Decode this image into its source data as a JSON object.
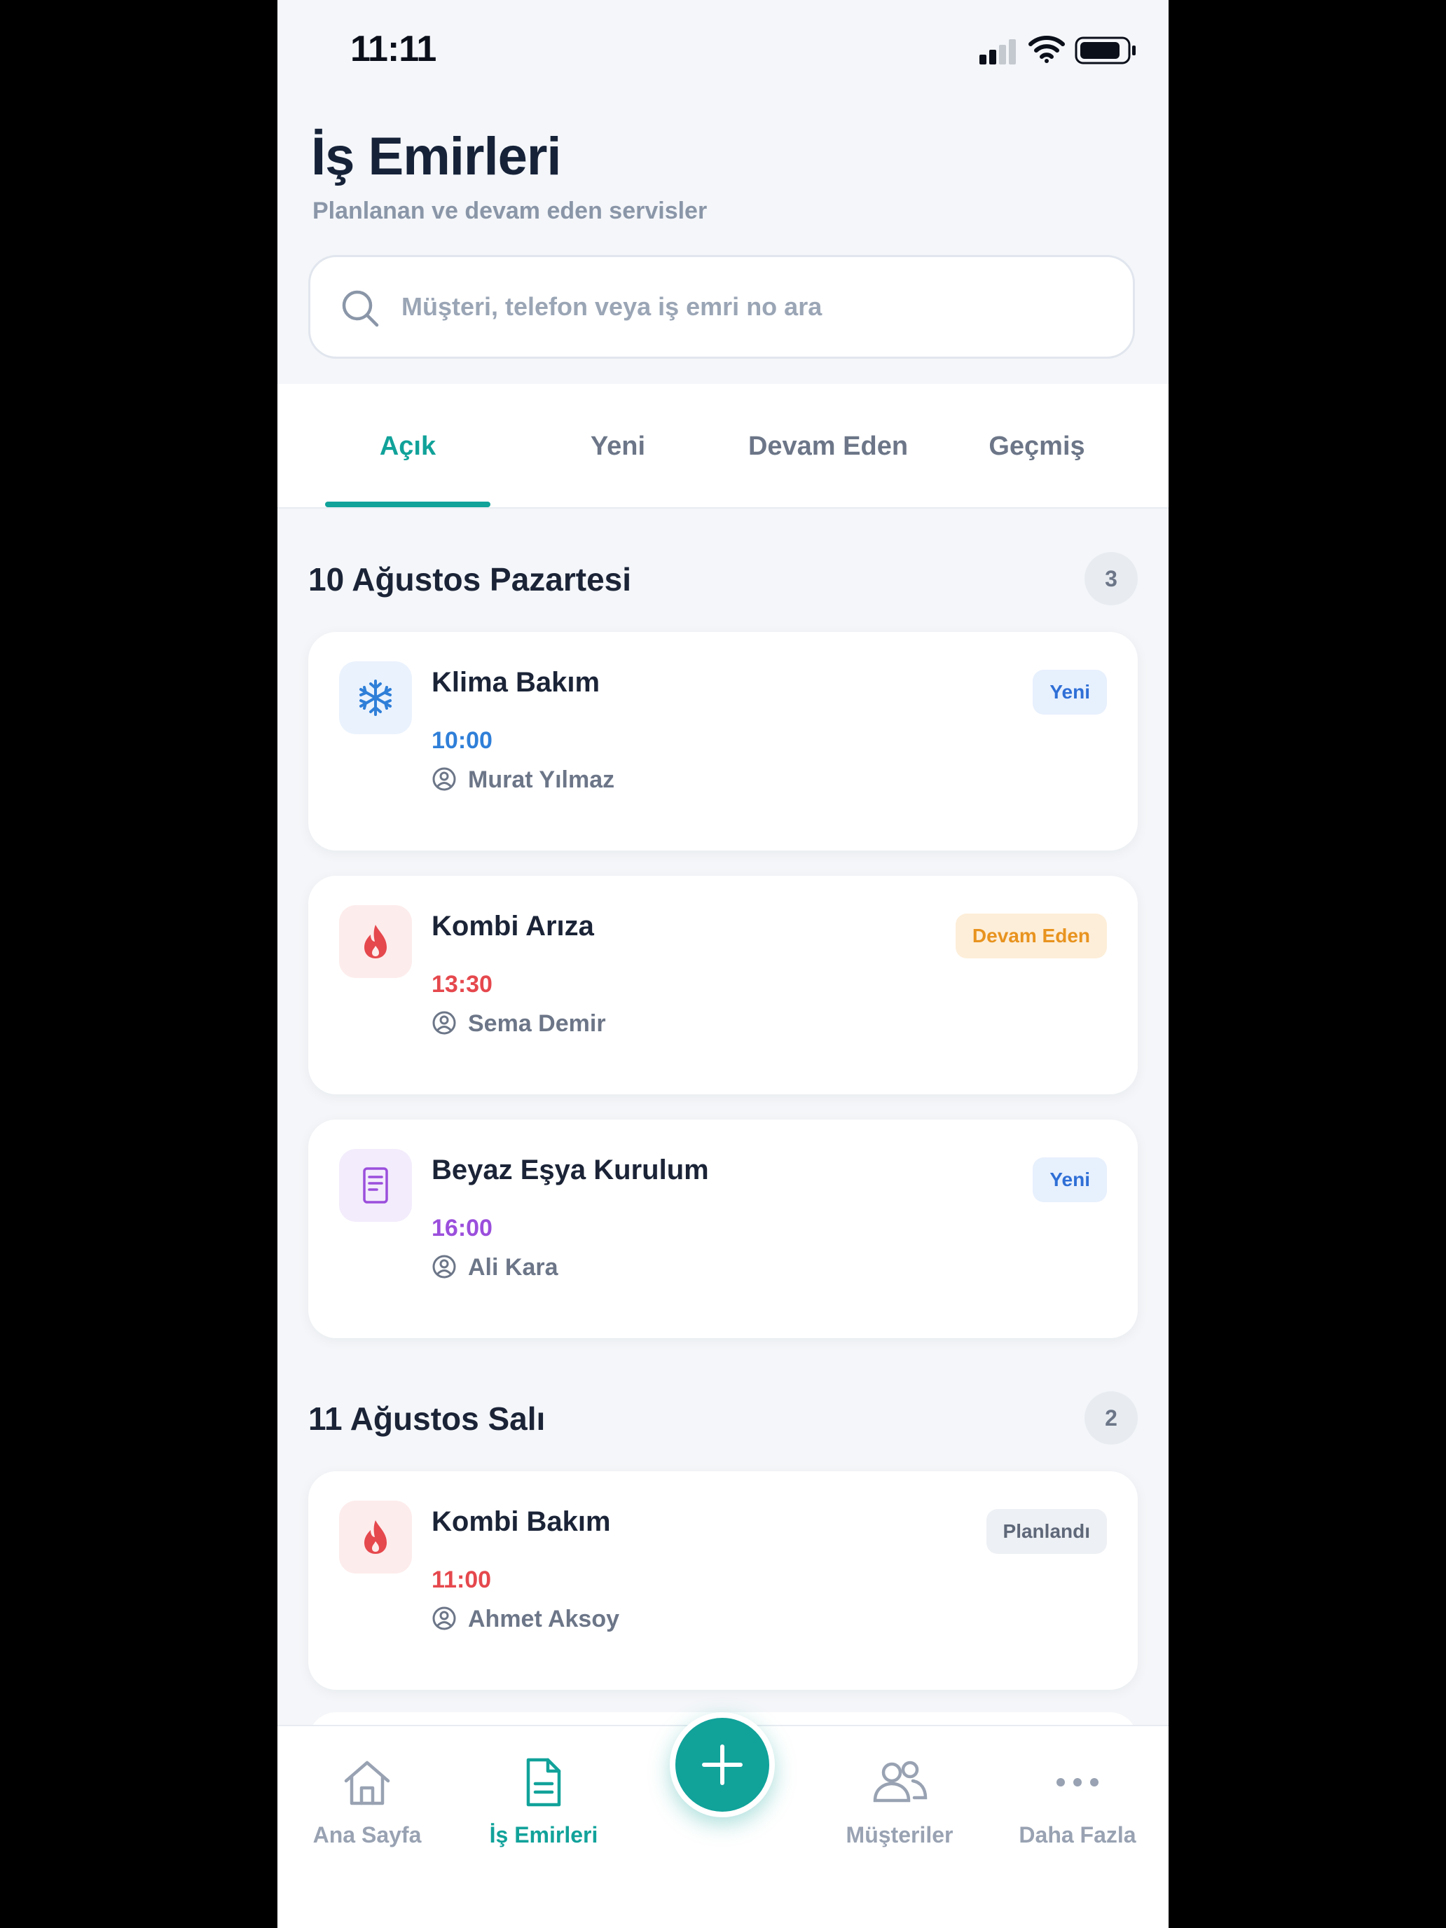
{
  "status_bar": {
    "time": "11:11"
  },
  "header": {
    "title": "İş Emirleri",
    "subtitle": "Planlanan ve devam eden servisler"
  },
  "search": {
    "placeholder": "Müşteri, telefon veya iş emri no ara"
  },
  "tabs": [
    {
      "label": "Açık",
      "active": true
    },
    {
      "label": "Yeni",
      "active": false
    },
    {
      "label": "Devam Eden",
      "active": false
    },
    {
      "label": "Geçmiş",
      "active": false
    }
  ],
  "sections": [
    {
      "title": "10 Ağustos Pazartesi",
      "count": "3",
      "items": [
        {
          "title": "Klima Bakım",
          "time": "10:00",
          "customer": "Murat Yılmaz",
          "status": "Yeni",
          "icon": "snowflake-icon",
          "color": "#2f7fd8",
          "icon_bg": "#eaf2fd"
        },
        {
          "title": "Kombi Arıza",
          "time": "13:30",
          "customer": "Sema Demir",
          "status": "Devam Eden",
          "icon": "flame-icon",
          "color": "#e5484d",
          "icon_bg": "#fdecec"
        },
        {
          "title": "Beyaz Eşya Kurulum",
          "time": "16:00",
          "customer": "Ali Kara",
          "status": "Yeni",
          "icon": "document-icon",
          "color": "#9b4fdc",
          "icon_bg": "#f3ecfc"
        }
      ]
    },
    {
      "title": "11 Ağustos Salı",
      "count": "2",
      "items": [
        {
          "title": "Kombi Bakım",
          "time": "11:00",
          "customer": "Ahmet Aksoy",
          "status": "Planlandı",
          "icon": "flame-icon",
          "color": "#e5484d",
          "icon_bg": "#fdecec"
        }
      ]
    }
  ],
  "bottom_nav": [
    {
      "label": "Ana Sayfa",
      "icon": "home-icon",
      "active": false
    },
    {
      "label": "İş Emirleri",
      "icon": "document-icon",
      "active": true
    },
    {
      "label": "Müşteriler",
      "icon": "users-icon",
      "active": false
    },
    {
      "label": "Daha Fazla",
      "icon": "more-icon",
      "active": false
    }
  ],
  "fab": {
    "icon": "plus-icon"
  },
  "colors": {
    "accent": "#11a29a",
    "background": "#f4f6f9",
    "text": "#1b2437"
  }
}
